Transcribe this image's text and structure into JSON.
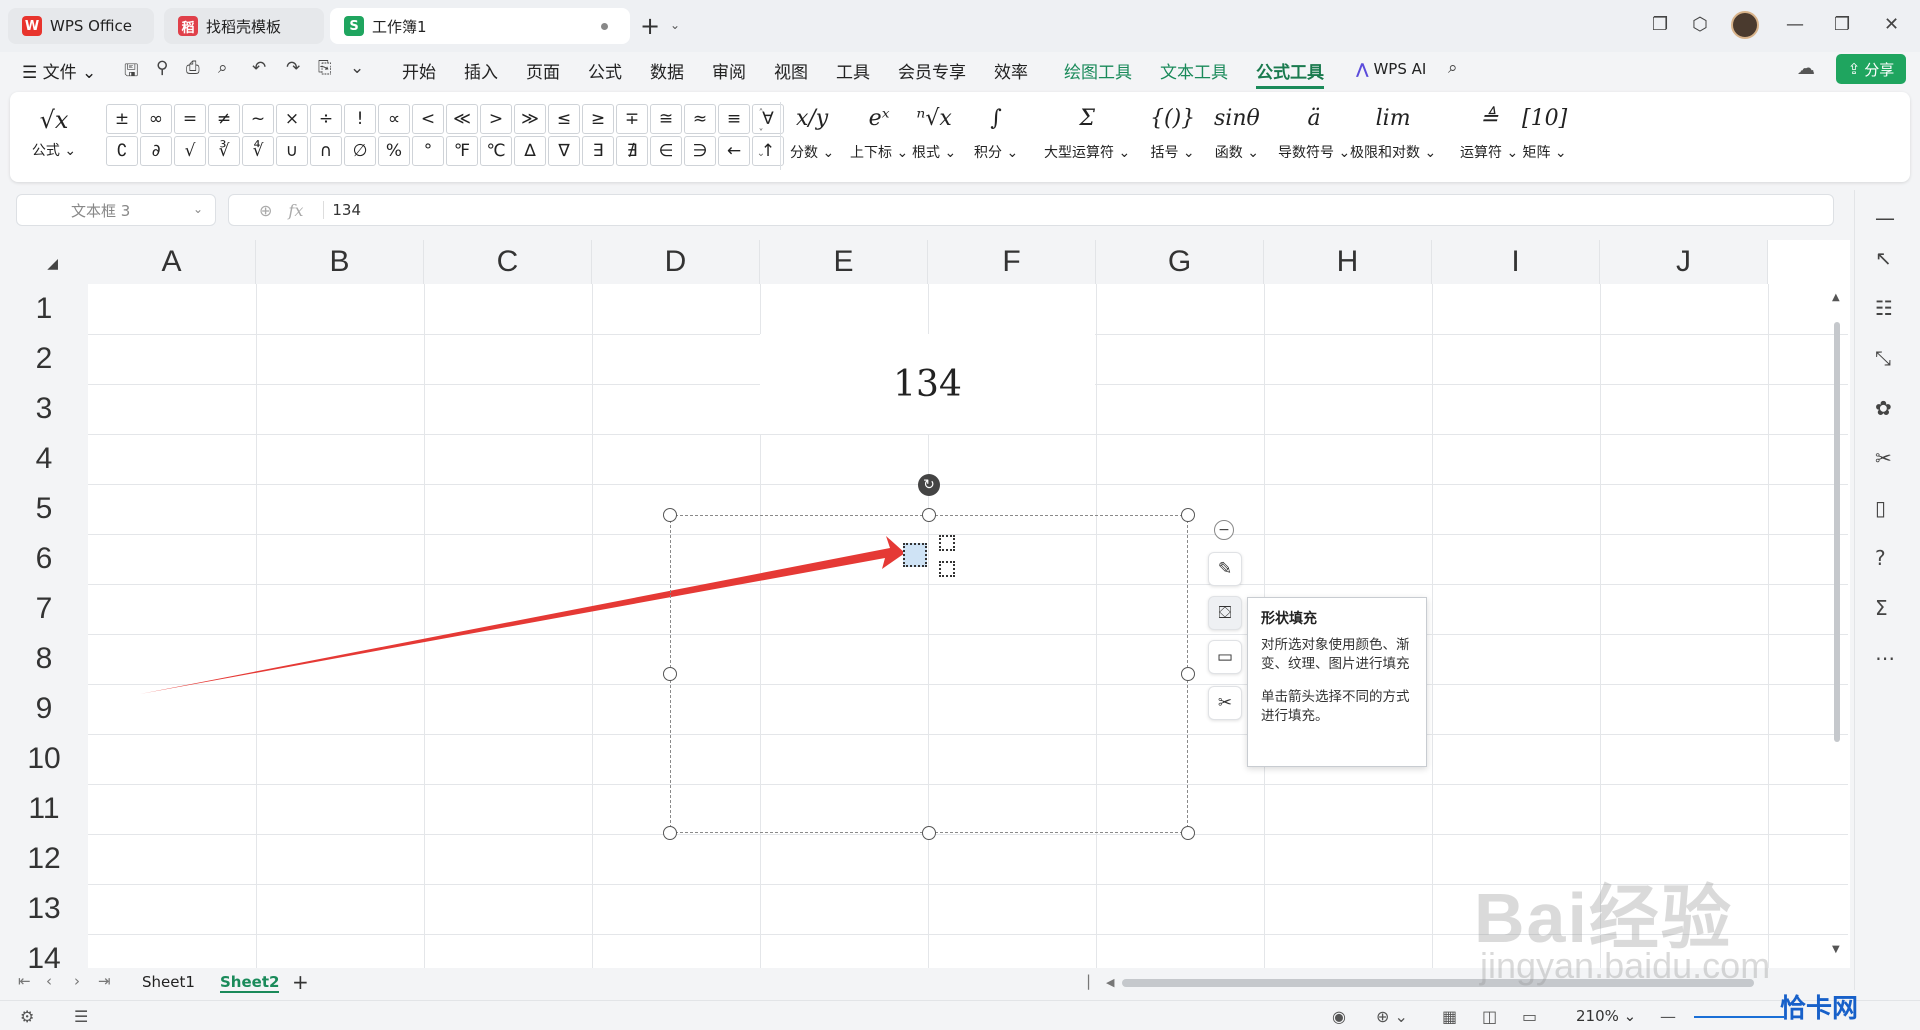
{
  "tabs": [
    {
      "label": "WPS Office",
      "logo": "W",
      "logo_color": "#e8342d"
    },
    {
      "label": "找稻壳模板",
      "logo": "稻",
      "logo_color": "#e0404a"
    },
    {
      "label": "工作簿1",
      "logo": "S",
      "logo_color": "#1fa55f"
    }
  ],
  "menu": {
    "file": "文件",
    "items": [
      "开始",
      "插入",
      "页面",
      "公式",
      "数据",
      "审阅",
      "视图",
      "工具",
      "会员专享",
      "效率"
    ],
    "context_items": [
      "绘图工具",
      "文本工具"
    ],
    "active": "公式工具",
    "ai": "WPS AI",
    "share": "分享"
  },
  "ribbon": {
    "formula_label": "公式",
    "symbols": [
      "±",
      "∞",
      "=",
      "≠",
      "~",
      "×",
      "÷",
      "!",
      "∝",
      "<",
      "≪",
      ">",
      "≫",
      "≤",
      "≥",
      "∓",
      "≅",
      "≈",
      "≡",
      "∀",
      "∁",
      "∂",
      "√",
      "∛",
      "∜",
      "∪",
      "∩",
      "∅",
      "%",
      "°",
      "℉",
      "℃",
      "∆",
      "∇",
      "∃",
      "∄",
      "∈",
      "∋",
      "←",
      "↑"
    ],
    "tools": [
      {
        "label": "分数",
        "icon": "x/y"
      },
      {
        "label": "上下标",
        "icon": "eˣ"
      },
      {
        "label": "根式",
        "icon": "ⁿ√x"
      },
      {
        "label": "积分",
        "icon": "∫"
      },
      {
        "label": "大型运算符",
        "icon": "Σ"
      },
      {
        "label": "括号",
        "icon": "{()}"
      },
      {
        "label": "函数",
        "icon": "sinθ"
      },
      {
        "label": "导数符号",
        "icon": "ä"
      },
      {
        "label": "极限和对数",
        "icon": "lim"
      },
      {
        "label": "运算符",
        "icon": "≜"
      },
      {
        "label": "矩阵",
        "icon": "[10]"
      }
    ]
  },
  "formula_bar": {
    "name_box": "文本框 3",
    "fx": "fx",
    "value": "134"
  },
  "sheet": {
    "columns": [
      "A",
      "B",
      "C",
      "D",
      "E",
      "F",
      "G",
      "H",
      "I",
      "J"
    ],
    "rows": [
      "1",
      "2",
      "3",
      "4",
      "5",
      "6",
      "7",
      "8",
      "9",
      "10",
      "11",
      "12",
      "13",
      "14"
    ],
    "merged_value": "134"
  },
  "tooltip": {
    "title": "形状填充",
    "body": "对所选对象使用颜色、渐变、纹理、图片进行填充",
    "hint": "单击箭头选择不同的方式进行填充。"
  },
  "sheet_tabs": [
    "Sheet1",
    "Sheet2"
  ],
  "active_sheet": "Sheet2",
  "status": {
    "zoom": "210%"
  },
  "watermark": {
    "baidu": "Bai经验",
    "baidu_url": "jingyan.baidu.com",
    "site": "恰卡网"
  },
  "colors": {
    "accent": "#1fa55f",
    "arrow": "#e53935"
  }
}
